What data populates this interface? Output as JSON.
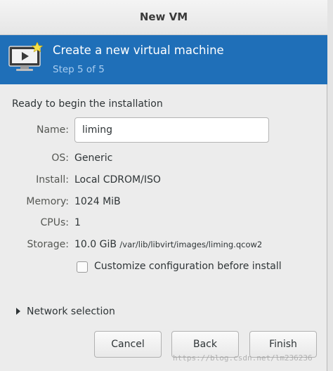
{
  "window": {
    "title": "New VM"
  },
  "banner": {
    "title": "Create a new virtual machine",
    "step": "Step 5 of 5"
  },
  "summary": {
    "heading": "Ready to begin the installation",
    "name_label": "Name:",
    "name_value": "liming",
    "os_label": "OS:",
    "os_value": "Generic",
    "install_label": "Install:",
    "install_value": "Local CDROM/ISO",
    "memory_label": "Memory:",
    "memory_value": "1024 MiB",
    "cpus_label": "CPUs:",
    "cpus_value": "1",
    "storage_label": "Storage:",
    "storage_size": "10.0 GiB",
    "storage_path": "/var/lib/libvirt/images/liming.qcow2"
  },
  "customize": {
    "label": "Customize configuration before install",
    "checked": false
  },
  "network": {
    "label": "Network selection"
  },
  "buttons": {
    "cancel": "Cancel",
    "back": "Back",
    "finish": "Finish"
  },
  "watermark": "https://blog.csdn.net/lm236236",
  "colors": {
    "banner": "#1f6fb8",
    "banner_subtitle": "#a9cdf0"
  }
}
